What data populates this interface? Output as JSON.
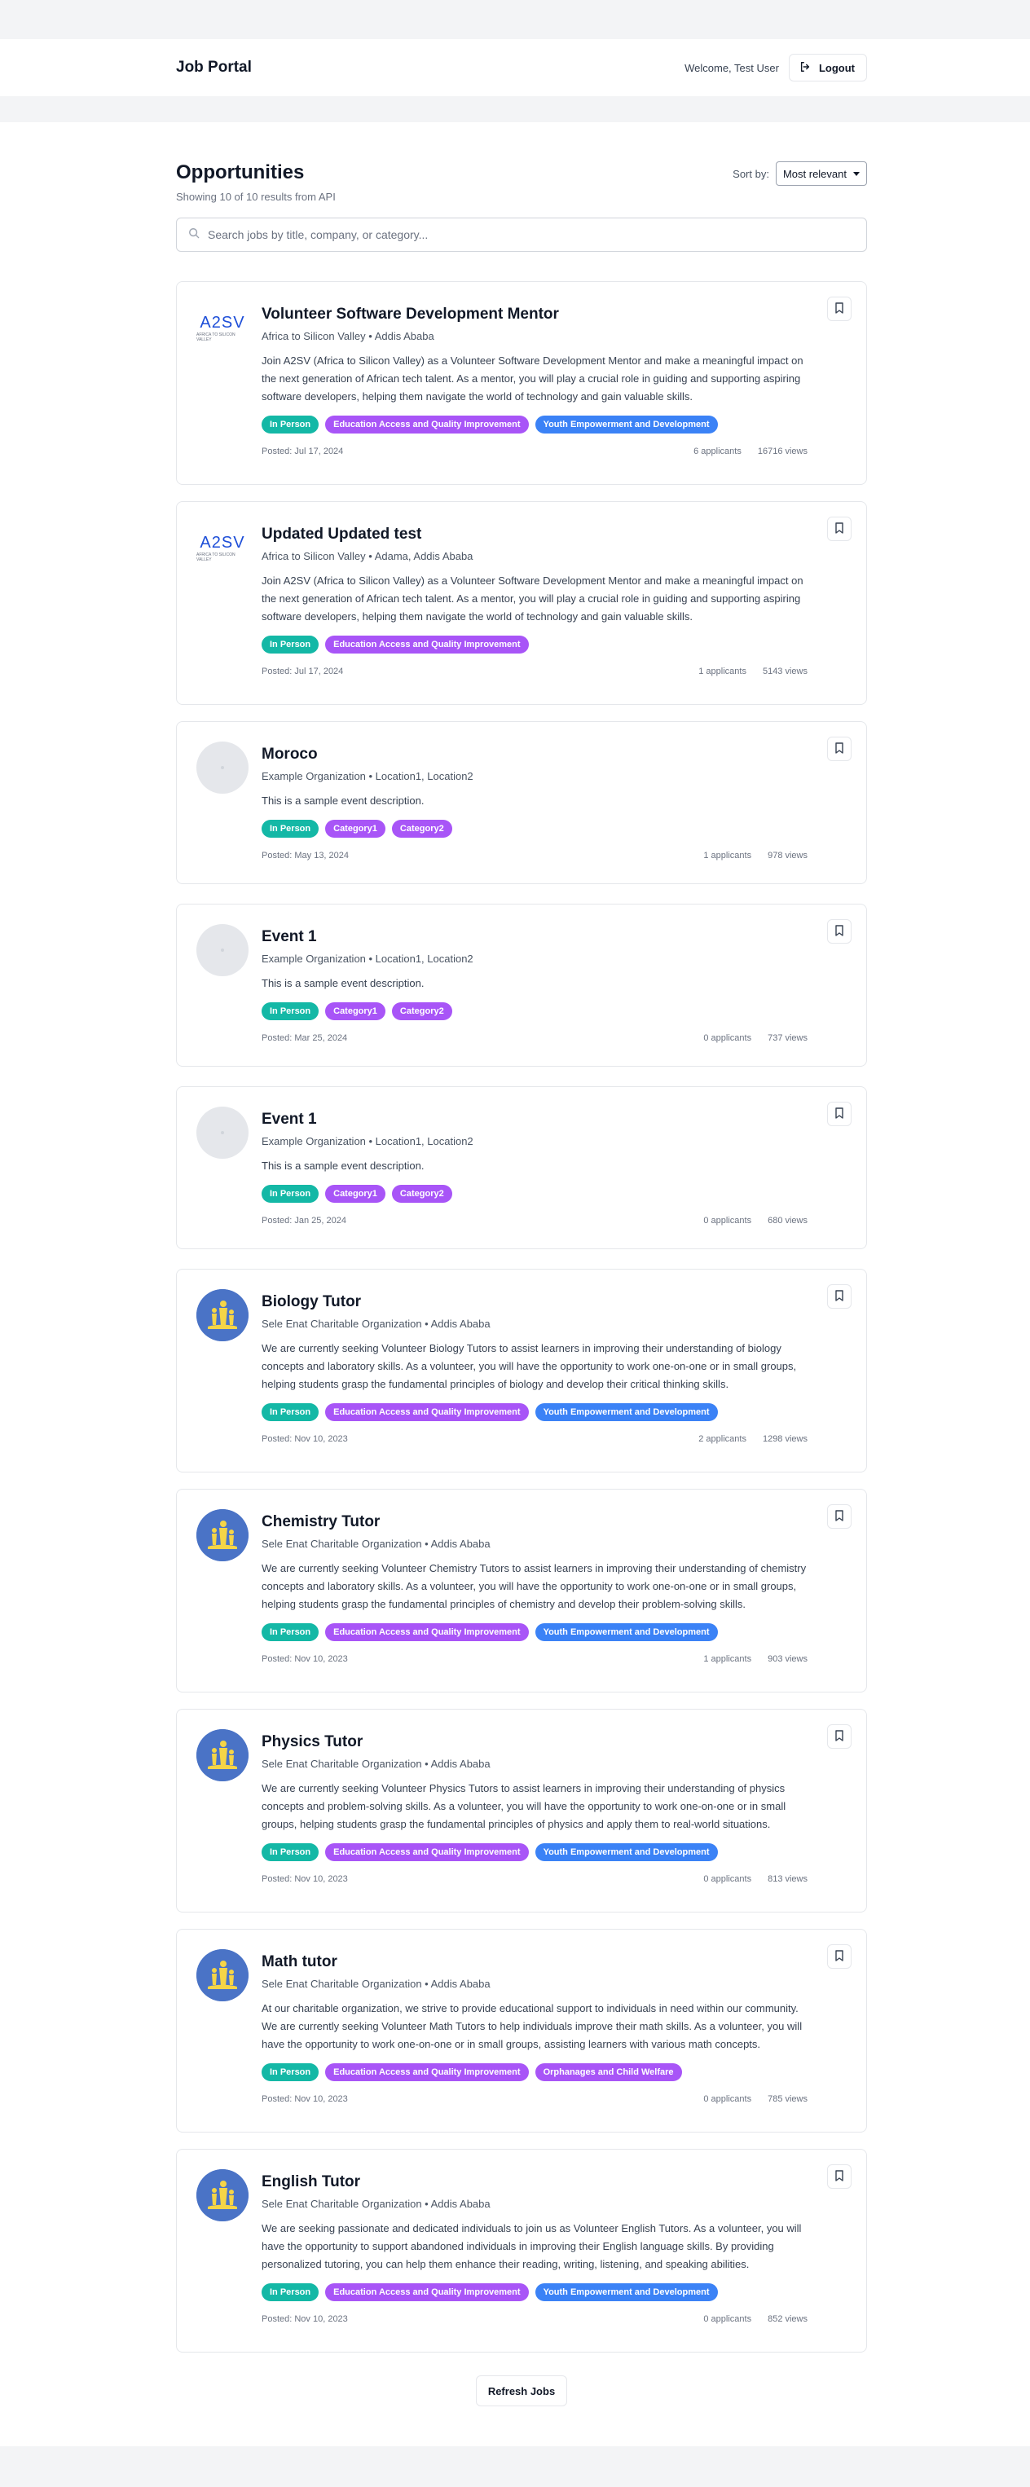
{
  "header": {
    "brand": "Job Portal",
    "welcome": "Welcome, Test User",
    "logout_label": "Logout"
  },
  "page": {
    "title": "Opportunities",
    "results_note": "Showing 10 of 10 results from API",
    "sort_label": "Sort by:",
    "sort_value": "Most relevant",
    "search_placeholder": "Search jobs by title, company, or category...",
    "refresh_label": "Refresh Jobs"
  },
  "colors": {
    "in_person_tag": "#14b8a6",
    "category_tag": "#a855f7",
    "youth_tag": "#3b82f6"
  },
  "jobs": [
    {
      "logo": "a2sv-logo",
      "title": "Volunteer Software Development Mentor",
      "meta": "Africa to Silicon Valley • Addis Ababa",
      "description": "Join A2SV (Africa to Silicon Valley) as a Volunteer Software Development Mentor and make a meaningful impact on the next generation of African tech talent. As a mentor, you will play a crucial role in guiding and supporting aspiring software developers, helping them navigate the world of technology and gain valuable skills.",
      "tags": [
        {
          "label": "In Person",
          "color": "green"
        },
        {
          "label": "Education Access and Quality Improvement",
          "color": "purple"
        },
        {
          "label": "Youth Empowerment and Development",
          "color": "blue"
        }
      ],
      "posted": "Posted: Jul 17, 2024",
      "applicants": "6 applicants",
      "views": "16716 views"
    },
    {
      "logo": "a2sv-logo",
      "title": "Updated Updated test",
      "meta": "Africa to Silicon Valley • Adama, Addis Ababa",
      "description": "Join A2SV (Africa to Silicon Valley) as a Volunteer Software Development Mentor and make a meaningful impact on the next generation of African tech talent. As a mentor, you will play a crucial role in guiding and supporting aspiring software developers, helping them navigate the world of technology and gain valuable skills.",
      "tags": [
        {
          "label": "In Person",
          "color": "green"
        },
        {
          "label": "Education Access and Quality Improvement",
          "color": "purple"
        }
      ],
      "posted": "Posted: Jul 17, 2024",
      "applicants": "1 applicants",
      "views": "5143 views"
    },
    {
      "logo": "placeholder",
      "title": "Moroco",
      "meta": "Example Organization • Location1, Location2",
      "description": "This is a sample event description.",
      "tags": [
        {
          "label": "In Person",
          "color": "green"
        },
        {
          "label": "Category1",
          "color": "purple"
        },
        {
          "label": "Category2",
          "color": "purple"
        }
      ],
      "posted": "Posted: May 13, 2024",
      "applicants": "1 applicants",
      "views": "978 views"
    },
    {
      "logo": "placeholder",
      "title": "Event 1",
      "meta": "Example Organization • Location1, Location2",
      "description": "This is a sample event description.",
      "tags": [
        {
          "label": "In Person",
          "color": "green"
        },
        {
          "label": "Category1",
          "color": "purple"
        },
        {
          "label": "Category2",
          "color": "purple"
        }
      ],
      "posted": "Posted: Mar 25, 2024",
      "applicants": "0 applicants",
      "views": "737 views"
    },
    {
      "logo": "placeholder",
      "title": "Event 1",
      "meta": "Example Organization • Location1, Location2",
      "description": "This is a sample event description.",
      "tags": [
        {
          "label": "In Person",
          "color": "green"
        },
        {
          "label": "Category1",
          "color": "purple"
        },
        {
          "label": "Category2",
          "color": "purple"
        }
      ],
      "posted": "Posted: Jan 25, 2024",
      "applicants": "0 applicants",
      "views": "680 views"
    },
    {
      "logo": "sele-enat-logo",
      "title": "Biology Tutor",
      "meta": "Sele Enat Charitable Organization • Addis Ababa",
      "description": "We are currently seeking Volunteer Biology Tutors to assist learners in improving their understanding of biology concepts and laboratory skills. As a volunteer, you will have the opportunity to work one-on-one or in small groups, helping students grasp the fundamental principles of biology and develop their critical thinking skills.",
      "tags": [
        {
          "label": "In Person",
          "color": "green"
        },
        {
          "label": "Education Access and Quality Improvement",
          "color": "purple"
        },
        {
          "label": "Youth Empowerment and Development",
          "color": "blue"
        }
      ],
      "posted": "Posted: Nov 10, 2023",
      "applicants": "2 applicants",
      "views": "1298 views"
    },
    {
      "logo": "sele-enat-logo",
      "title": "Chemistry Tutor",
      "meta": "Sele Enat Charitable Organization • Addis Ababa",
      "description": "We are currently seeking Volunteer Chemistry Tutors to assist learners in improving their understanding of chemistry concepts and laboratory skills. As a volunteer, you will have the opportunity to work one-on-one or in small groups, helping students grasp the fundamental principles of chemistry and develop their problem-solving skills.",
      "tags": [
        {
          "label": "In Person",
          "color": "green"
        },
        {
          "label": "Education Access and Quality Improvement",
          "color": "purple"
        },
        {
          "label": "Youth Empowerment and Development",
          "color": "blue"
        }
      ],
      "posted": "Posted: Nov 10, 2023",
      "applicants": "1 applicants",
      "views": "903 views"
    },
    {
      "logo": "sele-enat-logo",
      "title": "Physics Tutor",
      "meta": "Sele Enat Charitable Organization • Addis Ababa",
      "description": "We are currently seeking Volunteer Physics Tutors to assist learners in improving their understanding of physics concepts and problem-solving skills. As a volunteer, you will have the opportunity to work one-on-one or in small groups, helping students grasp the fundamental principles of physics and apply them to real-world situations.",
      "tags": [
        {
          "label": "In Person",
          "color": "green"
        },
        {
          "label": "Education Access and Quality Improvement",
          "color": "purple"
        },
        {
          "label": "Youth Empowerment and Development",
          "color": "blue"
        }
      ],
      "posted": "Posted: Nov 10, 2023",
      "applicants": "0 applicants",
      "views": "813 views"
    },
    {
      "logo": "sele-enat-logo",
      "title": "Math tutor",
      "meta": "Sele Enat Charitable Organization • Addis Ababa",
      "description": "At our charitable organization, we strive to provide educational support to individuals in need within our community. We are currently seeking Volunteer Math Tutors to help individuals improve their math skills. As a volunteer, you will have the opportunity to work one-on-one or in small groups, assisting learners with various math concepts.",
      "tags": [
        {
          "label": "In Person",
          "color": "green"
        },
        {
          "label": "Education Access and Quality Improvement",
          "color": "purple"
        },
        {
          "label": "Orphanages and Child Welfare",
          "color": "purple"
        }
      ],
      "posted": "Posted: Nov 10, 2023",
      "applicants": "0 applicants",
      "views": "785 views"
    },
    {
      "logo": "sele-enat-logo",
      "title": "English Tutor",
      "meta": "Sele Enat Charitable Organization • Addis Ababa",
      "description": "We are seeking passionate and dedicated individuals to join us as Volunteer English Tutors. As a volunteer, you will have the opportunity to support abandoned individuals in improving their English language skills. By providing personalized tutoring, you can help them enhance their reading, writing, listening, and speaking abilities.",
      "tags": [
        {
          "label": "In Person",
          "color": "green"
        },
        {
          "label": "Education Access and Quality Improvement",
          "color": "purple"
        },
        {
          "label": "Youth Empowerment and Development",
          "color": "blue"
        }
      ],
      "posted": "Posted: Nov 10, 2023",
      "applicants": "0 applicants",
      "views": "852 views"
    }
  ]
}
